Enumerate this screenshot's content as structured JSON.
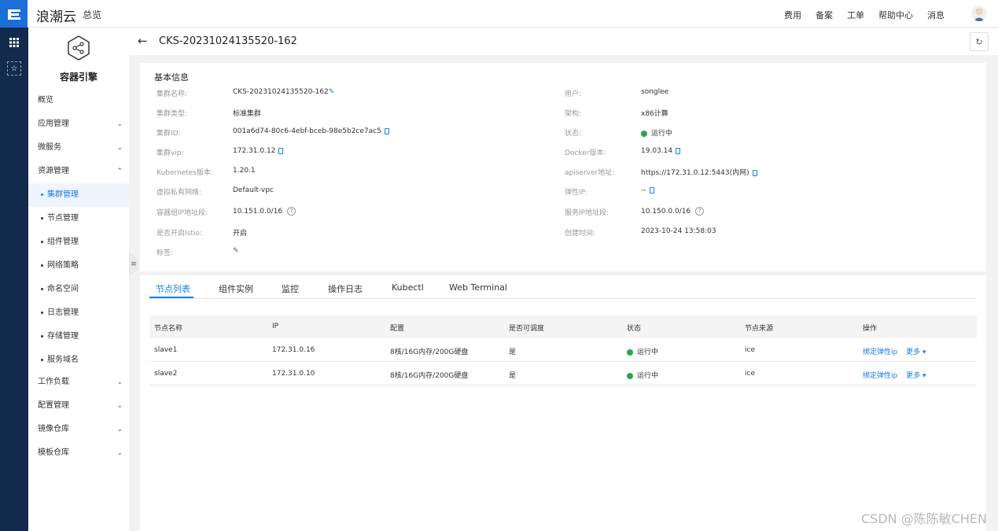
{
  "topbar": {
    "brand": "浪潮云",
    "overview": "总览",
    "right_links": [
      "费用",
      "备案",
      "工单",
      "帮助中心",
      "消息"
    ]
  },
  "sidebar": {
    "product_title": "容器引擎",
    "items": [
      {
        "label": "概览",
        "has_chevron": false
      },
      {
        "label": "应用管理",
        "has_chevron": true,
        "chevron": "down"
      },
      {
        "label": "微服务",
        "has_chevron": true,
        "chevron": "down"
      },
      {
        "label": "资源管理",
        "has_chevron": true,
        "chevron": "up"
      }
    ],
    "sub_items": [
      {
        "label": "集群管理",
        "active": true
      },
      {
        "label": "节点管理",
        "active": false
      },
      {
        "label": "组件管理",
        "active": false
      },
      {
        "label": "网络策略",
        "active": false
      },
      {
        "label": "命名空间",
        "active": false
      },
      {
        "label": "日志管理",
        "active": false
      },
      {
        "label": "存储管理",
        "active": false
      },
      {
        "label": "服务域名",
        "active": false
      }
    ],
    "bottom_items": [
      {
        "label": "工作负载"
      },
      {
        "label": "配置管理"
      },
      {
        "label": "镜像仓库"
      },
      {
        "label": "模板仓库"
      }
    ]
  },
  "header": {
    "cluster_title": "CKS-20231024135520-162"
  },
  "basic_info": {
    "section_title": "基本信息",
    "left": [
      {
        "label": "集群名称:",
        "value": "CKS-20231024135520-162",
        "icon": "edit"
      },
      {
        "label": "集群类型:",
        "value": "标准集群"
      },
      {
        "label": "集群ID:",
        "value": "001a6d74-80c6-4ebf-bceb-98e5b2ce7ac5",
        "icon": "copy"
      },
      {
        "label": "集群vip:",
        "value": "172.31.0.12",
        "icon": "copy"
      },
      {
        "label": "Kubernetes版本:",
        "value": "1.20.1"
      },
      {
        "label": "虚拟私有网络:",
        "value": "Default-vpc"
      },
      {
        "label": "容器组IP地址段:",
        "value": "10.151.0.0/16",
        "icon": "help"
      },
      {
        "label": "是否开启Istio:",
        "value": "开启"
      },
      {
        "label": "标签:",
        "value": "",
        "icon": "edit"
      }
    ],
    "right": [
      {
        "label": "用户:",
        "value": "songlee"
      },
      {
        "label": "架构:",
        "value": "x86计算"
      },
      {
        "label": "状态:",
        "value": "运行中",
        "icon": "status"
      },
      {
        "label": "Docker版本:",
        "value": "19.03.14",
        "icon": "copy"
      },
      {
        "label": "apiserver地址:",
        "value": "https://172.31.0.12:5443(内网)",
        "icon": "copy"
      },
      {
        "label": "弹性IP:",
        "value": "--",
        "icon": "copy"
      },
      {
        "label": "服务IP地址段:",
        "value": "10.150.0.0/16",
        "icon": "help"
      },
      {
        "label": "创建时间:",
        "value": "2023-10-24 13:58:03"
      }
    ]
  },
  "tabs": [
    "节点列表",
    "组件实例",
    "监控",
    "操作日志",
    "Kubectl",
    "Web Terminal"
  ],
  "table": {
    "columns": [
      "节点名称",
      "IP",
      "配置",
      "是否可调度",
      "状态",
      "节点来源",
      "操作"
    ],
    "rows": [
      {
        "name": "slave1",
        "ip": "172.31.0.16",
        "config": "8核/16G内存/200G硬盘",
        "schedulable": "是",
        "status": "运行中",
        "source": "ice",
        "action1": "绑定弹性ip",
        "action2": "更多"
      },
      {
        "name": "slave2",
        "ip": "172.31.0.10",
        "config": "8核/16G内存/200G硬盘",
        "schedulable": "是",
        "status": "运行中",
        "source": "ice",
        "action1": "绑定弹性ip",
        "action2": "更多"
      }
    ]
  },
  "watermark": "CSDN @陈陈敏CHEN",
  "colors": {
    "accent": "#1a7de6",
    "sidebar_dark": "#122b4c",
    "status_green": "#28a745"
  }
}
